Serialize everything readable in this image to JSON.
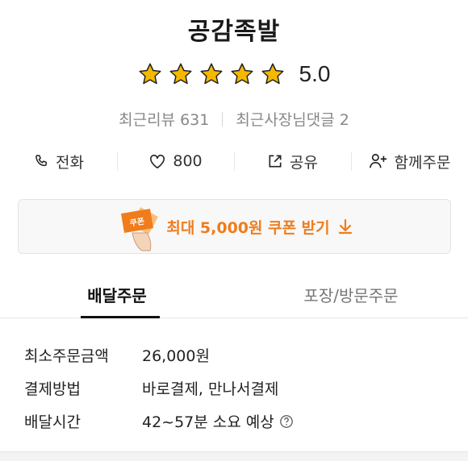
{
  "store": {
    "name": "공감족발",
    "rating": "5.0",
    "stars_filled": 5,
    "stars_total": 5,
    "recent_reviews": "최근리뷰 631",
    "owner_replies": "최근사장님댓글 2"
  },
  "actions": [
    {
      "label": "전화",
      "icon": "phone-icon"
    },
    {
      "label": "800",
      "icon": "heart-icon"
    },
    {
      "label": "공유",
      "icon": "share-icon"
    },
    {
      "label": "함께주문",
      "icon": "add-person-icon"
    }
  ],
  "coupon": {
    "label": "최대 5,000원 쿠폰 받기",
    "badge_text": "쿠폰",
    "icon": "download-arrow-icon",
    "accent_color": "#f07c1b"
  },
  "tabs": [
    {
      "label": "배달주문",
      "active": true
    },
    {
      "label": "포장/방문주문",
      "active": false
    }
  ],
  "info": [
    {
      "label": "최소주문금액",
      "value": "26,000원"
    },
    {
      "label": "결제방법",
      "value": "바로결제, 만나서결제"
    },
    {
      "label": "배달시간",
      "value": "42~57분 소요 예상"
    }
  ],
  "colors": {
    "star": "#f5b800",
    "accent": "#f07c1b"
  }
}
